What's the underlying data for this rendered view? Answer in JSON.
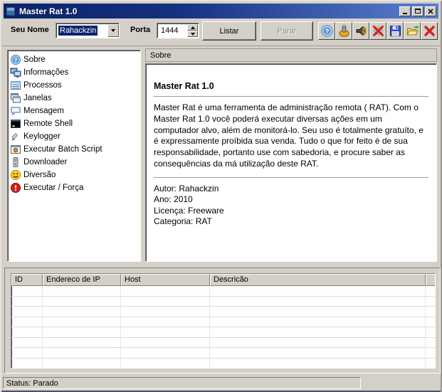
{
  "window": {
    "title": "Master Rat 1.0"
  },
  "toolbar": {
    "name_label": "Seu Nome",
    "name_value": "Rahackzin",
    "port_label": "Porta",
    "port_value": "1444",
    "listar_label": "Listar",
    "parar_label": "Parar",
    "icon_buttons": [
      {
        "icon": "help-icon"
      },
      {
        "icon": "bell-icon"
      },
      {
        "icon": "speaker-icon"
      },
      {
        "icon": "disconnect-icon"
      },
      {
        "icon": "save-icon"
      },
      {
        "icon": "open-folder-icon"
      },
      {
        "icon": "exit-icon"
      }
    ]
  },
  "sidebar": {
    "items": [
      {
        "label": "Sobre",
        "icon": "help-icon"
      },
      {
        "label": "Informações",
        "icon": "computers-icon"
      },
      {
        "label": "Processos",
        "icon": "process-list-icon"
      },
      {
        "label": "Janelas",
        "icon": "windows-icon"
      },
      {
        "label": "Mensagem",
        "icon": "message-bubble-icon"
      },
      {
        "label": "Remote Shell",
        "icon": "console-icon"
      },
      {
        "label": "Keylogger",
        "icon": "pencil-icon"
      },
      {
        "label": "Executar Batch Script",
        "icon": "batch-script-icon"
      },
      {
        "label": "Downloader",
        "icon": "download-tower-icon"
      },
      {
        "label": "Diversão",
        "icon": "smiley-icon"
      },
      {
        "label": "Executar / Força",
        "icon": "force-exec-icon"
      }
    ]
  },
  "about": {
    "header": "Sobre",
    "title": "Master Rat 1.0",
    "body": "Master Rat é uma ferramenta de administração remota ( RAT). Com o Master Rat 1.0 você poderá executar diversas ações em um computador alvo, além de monitorá-lo. Seu uso é totalmente gratuíto, e é expressamente proíbida sua venda. Tudo o que for feito é de sua responsabilidade, portanto use com sabedoria, e procure saber as consequências  da má utilização deste RAT.",
    "info": [
      "Autor: Rahackzin",
      "Ano: 2010",
      "Licença: Freeware",
      "Categoria: RAT"
    ]
  },
  "connections_table": {
    "columns": [
      "ID",
      "Endereco de IP",
      "Host",
      "Descricão"
    ],
    "rows": []
  },
  "statusbar": {
    "text": "Status: Parado"
  },
  "colors": {
    "titlebar_start": "#0a246a",
    "titlebar_end": "#5a7fd0",
    "chrome": "#d4d0c8",
    "selection": "#0a246a"
  }
}
